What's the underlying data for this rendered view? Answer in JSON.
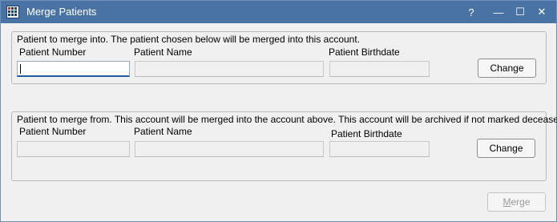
{
  "window": {
    "title": "Merge Patients",
    "controls": {
      "help": "?",
      "minimize": "—",
      "maximize": "☐",
      "close": "✕"
    }
  },
  "merge_into": {
    "caption": "Patient to merge into. The patient chosen below will be merged into this account.",
    "patient_number_label": "Patient Number",
    "patient_name_label": "Patient Name",
    "patient_birthdate_label": "Patient Birthdate",
    "patient_number_value": "",
    "patient_name_value": "",
    "patient_birthdate_value": "",
    "change_label": "Change"
  },
  "merge_from": {
    "caption": "Patient to merge from. This account will be merged into the account above. This account will be archived if not marked deceased.",
    "patient_number_label": "Patient Number",
    "patient_name_label": "Patient Name",
    "patient_birthdate_label": "Patient Birthdate",
    "patient_number_value": "",
    "patient_name_value": "",
    "patient_birthdate_value": "",
    "change_label": "Change"
  },
  "footer": {
    "merge_mnemonic": "M",
    "merge_rest": "erge",
    "merge_enabled": false
  },
  "colors": {
    "titlebar": "#4a73a5",
    "focus_underline": "#1e5fa8"
  }
}
